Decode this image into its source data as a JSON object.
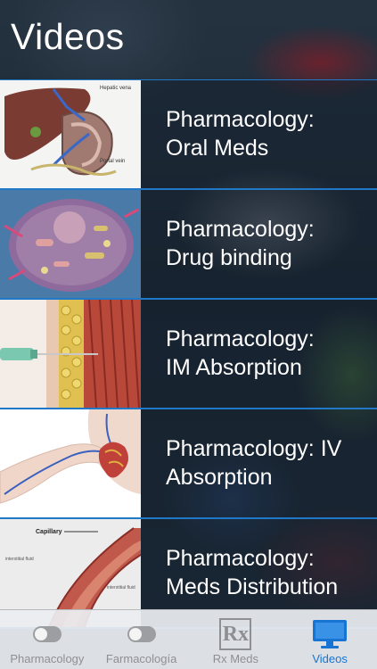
{
  "header": {
    "title": "Videos"
  },
  "videos": [
    {
      "line1": "Pharmacology:",
      "line2": "Oral Meds",
      "thumb": "liver-portal-vein",
      "thumb_labels": [
        "Hepatic vena",
        "Portal vein"
      ]
    },
    {
      "line1": "Pharmacology:",
      "line2": "Drug binding",
      "thumb": "cell-drug-binding"
    },
    {
      "line1": "Pharmacology:",
      "line2": "IM Absorption",
      "thumb": "intramuscular-injection"
    },
    {
      "line1": "Pharmacology: IV",
      "line2": "Absorption",
      "thumb": "iv-heart"
    },
    {
      "line1": "Pharmacology:",
      "line2": "Meds Distribution",
      "thumb": "capillary",
      "thumb_labels": [
        "Capillary",
        "interstitial fluid",
        "interstitial fluid"
      ]
    }
  ],
  "tabbar": {
    "tabs": [
      {
        "label": "Pharmacology",
        "icon": "toggle-icon",
        "active": false
      },
      {
        "label": "Farmacología",
        "icon": "toggle-icon",
        "active": false
      },
      {
        "label": "Rx Meds",
        "icon": "rx-icon",
        "icon_text": "Rx",
        "active": false
      },
      {
        "label": "Videos",
        "icon": "monitor-icon",
        "active": true
      }
    ],
    "active_color": "#1874d2",
    "inactive_color": "#8d8f94"
  },
  "colors": {
    "separator": "#1f78c8"
  }
}
